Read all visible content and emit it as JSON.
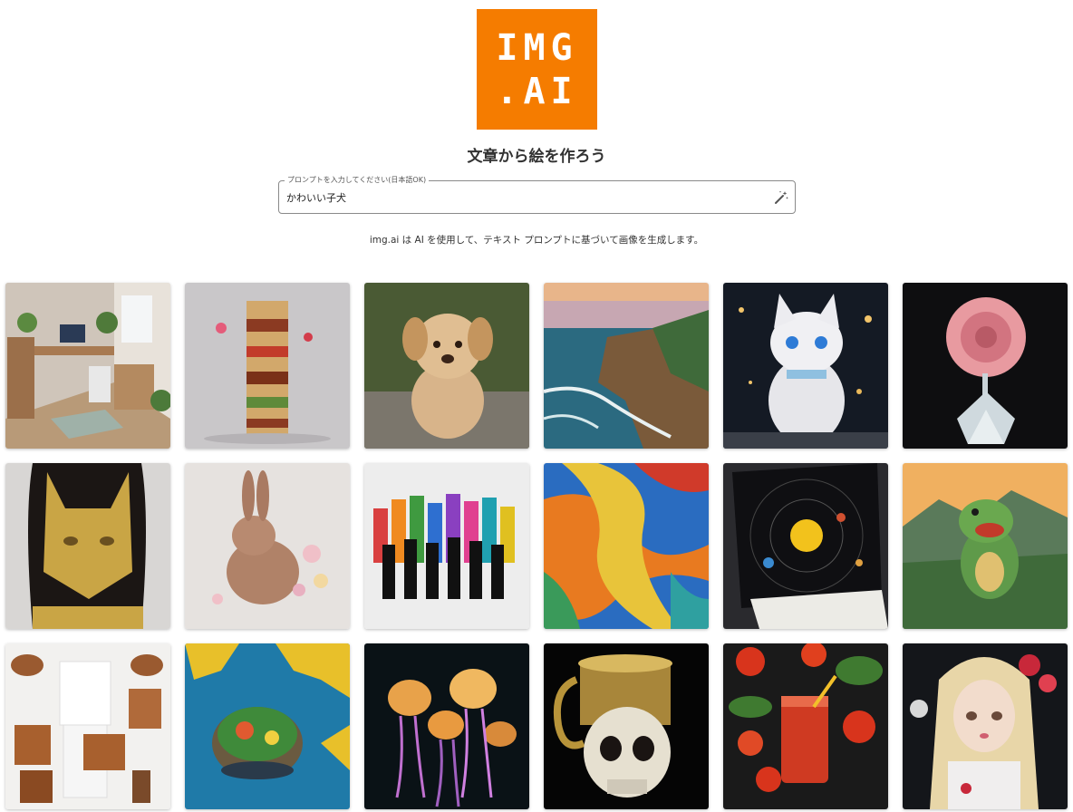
{
  "logo": {
    "line1": "IMG",
    "line2": ".AI",
    "color": "#f57c00"
  },
  "tagline": "文章から絵を作ろう",
  "prompt": {
    "label": "プロンプトを入力してください(日本語OK)",
    "value": "かわいい子犬",
    "icon": "magic-wand-icon"
  },
  "description": "img.ai は AI を使用して、テキスト プロンプトに基づいて画像を生成します。",
  "gallery": [
    {
      "name": "gallery-image-isometric-room"
    },
    {
      "name": "gallery-image-sandwich-tower"
    },
    {
      "name": "gallery-image-puppy"
    },
    {
      "name": "gallery-image-coastal-cliffs"
    },
    {
      "name": "gallery-image-sparkly-kitten"
    },
    {
      "name": "gallery-image-glass-rose"
    },
    {
      "name": "gallery-image-gold-cat-mask"
    },
    {
      "name": "gallery-image-floral-rabbit"
    },
    {
      "name": "gallery-image-dancing-silhouettes"
    },
    {
      "name": "gallery-image-abstract-paint"
    },
    {
      "name": "gallery-image-solar-system-book"
    },
    {
      "name": "gallery-image-baby-dinosaur"
    },
    {
      "name": "gallery-image-fashion-flatlay"
    },
    {
      "name": "gallery-image-island-map"
    },
    {
      "name": "gallery-image-jellyfish"
    },
    {
      "name": "gallery-image-skull-mug"
    },
    {
      "name": "gallery-image-tomato-juice"
    },
    {
      "name": "gallery-image-anime-girl"
    }
  ]
}
